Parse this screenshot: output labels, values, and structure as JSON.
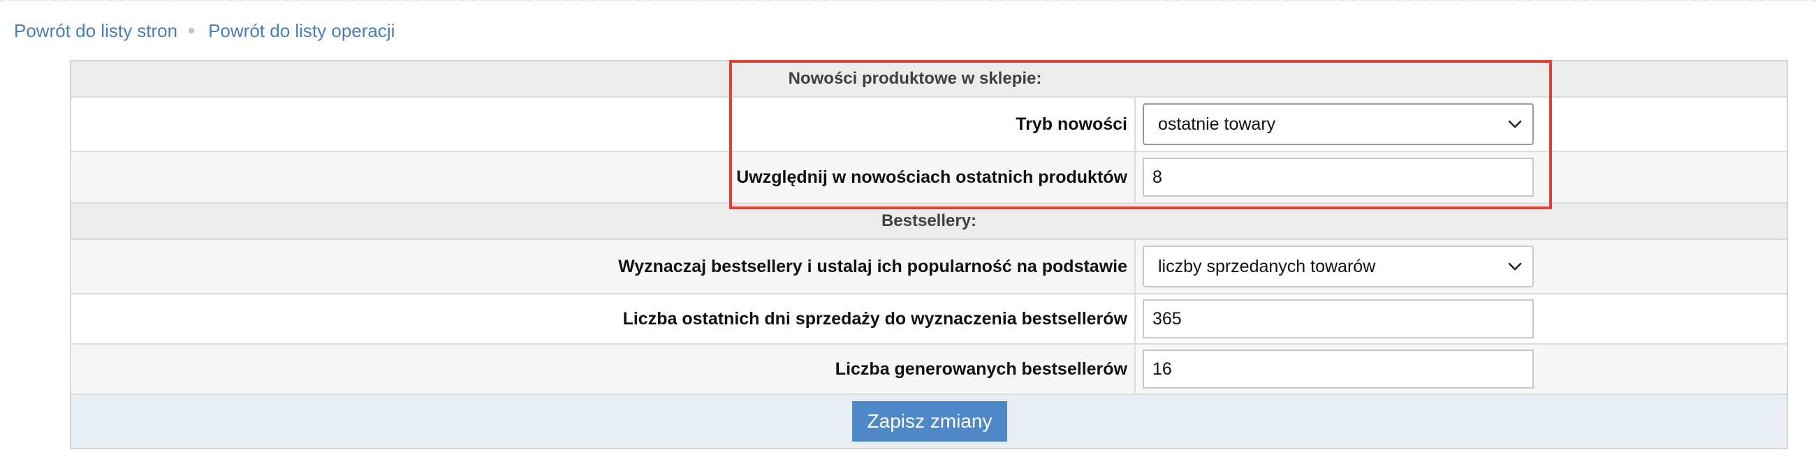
{
  "breadcrumbs": [
    {
      "label": "Powrót do listy stron"
    },
    {
      "label": "Powrót do listy operacji"
    }
  ],
  "sections": {
    "new_products": {
      "title": "Nowości produktowe w sklepie:",
      "mode_label": "Tryb nowości",
      "mode_value": "ostatnie towary",
      "count_label": "Uwzględnij w nowościach ostatnich produktów",
      "count_value": "8"
    },
    "bestsellers": {
      "title": "Bestsellery:",
      "basis_label": "Wyznaczaj bestsellery i ustalaj ich popularność na podstawie",
      "basis_value": "liczby sprzedanych towarów",
      "days_label": "Liczba ostatnich dni sprzedaży do wyznaczenia bestsellerów",
      "days_value": "365",
      "generated_label": "Liczba generowanych bestsellerów",
      "generated_value": "16"
    }
  },
  "actions": {
    "save_label": "Zapisz zmiany"
  },
  "colors": {
    "link": "#4a7fb5",
    "highlight": "#e04131",
    "button": "#4e88c7"
  }
}
